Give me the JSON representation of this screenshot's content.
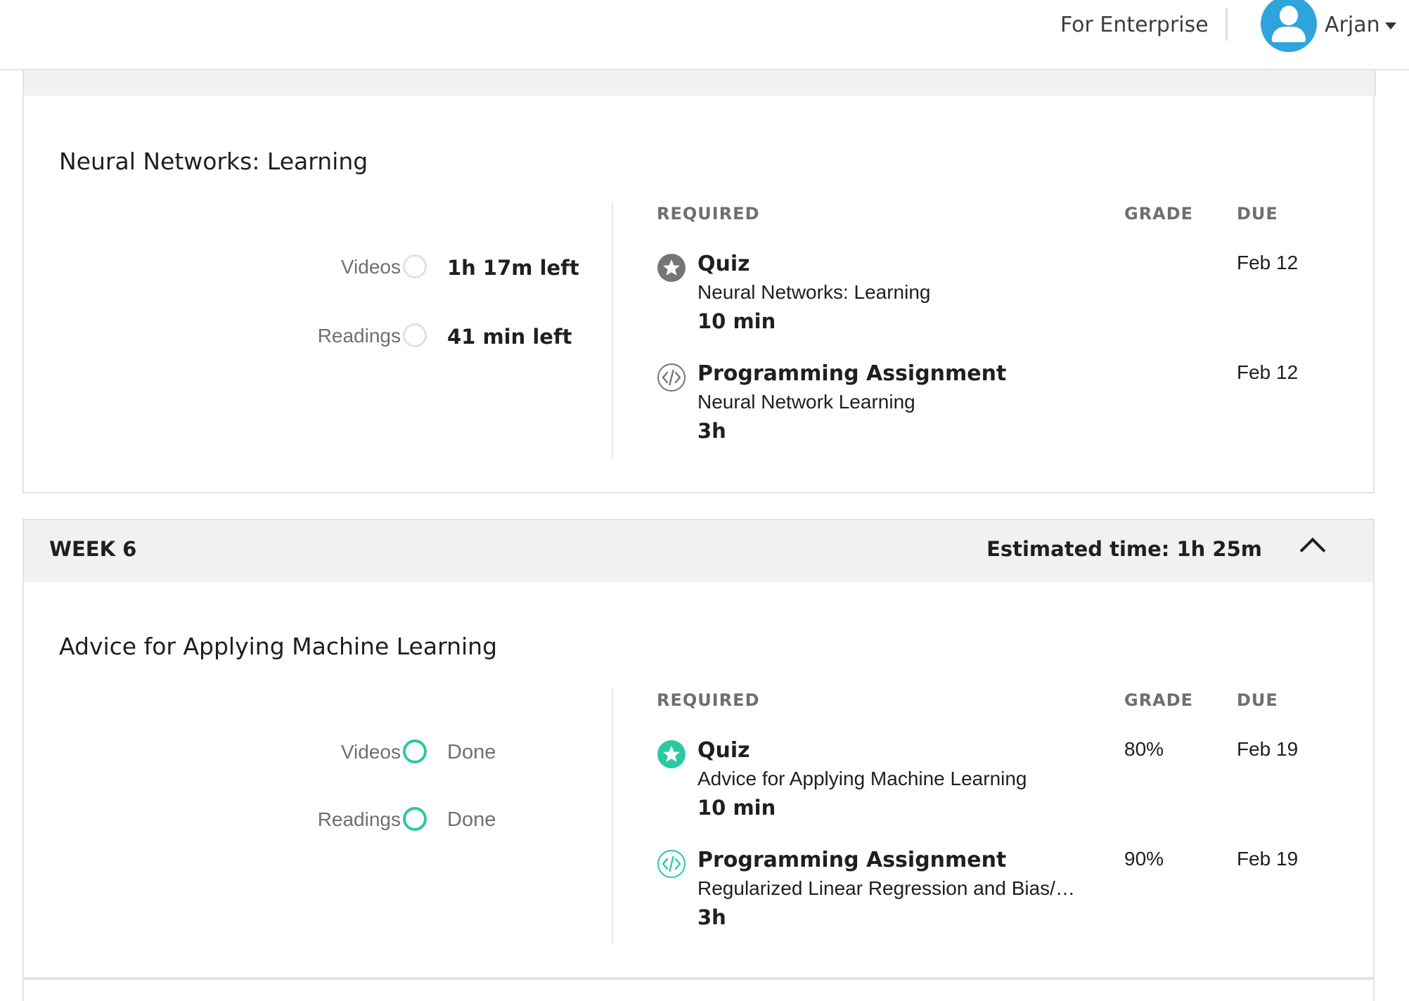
{
  "header": {
    "enterprise_link": "For Enterprise",
    "user_name": "Arjan",
    "avatar_color": "#2fa4dc"
  },
  "colors": {
    "done_green": "#2bc9a0",
    "pending_gray": "#757575",
    "strip_bg": "#f1f1f1"
  },
  "sections": [
    {
      "lesson_title": "Neural Networks: Learning",
      "progress": [
        {
          "label": "Videos",
          "status": "1h 17m left",
          "state": "pending"
        },
        {
          "label": "Readings",
          "status": "41 min left",
          "state": "pending"
        }
      ],
      "columns": {
        "required": "REQUIRED",
        "grade": "GRADE",
        "due": "DUE"
      },
      "items": [
        {
          "icon": "star-icon",
          "type": "Quiz",
          "name": "Neural Networks: Learning",
          "duration": "10 min",
          "grade": "",
          "due": "Feb 12",
          "state": "pending"
        },
        {
          "icon": "code-icon",
          "type": "Programming Assignment",
          "name": "Neural Network Learning",
          "duration": "3h",
          "grade": "",
          "due": "Feb 12",
          "state": "pending"
        }
      ]
    },
    {
      "week_label": "WEEK 6",
      "estimated_time": "Estimated time: 1h 25m",
      "lesson_title": "Advice for Applying Machine Learning",
      "progress": [
        {
          "label": "Videos",
          "status": "Done",
          "state": "done"
        },
        {
          "label": "Readings",
          "status": "Done",
          "state": "done"
        }
      ],
      "columns": {
        "required": "REQUIRED",
        "grade": "GRADE",
        "due": "DUE"
      },
      "items": [
        {
          "icon": "star-icon",
          "type": "Quiz",
          "name": "Advice for Applying Machine Learning",
          "duration": "10 min",
          "grade": "80%",
          "due": "Feb 19",
          "state": "done"
        },
        {
          "icon": "code-icon",
          "type": "Programming Assignment",
          "name": "Regularized Linear Regression and Bias/…",
          "duration": "3h",
          "grade": "90%",
          "due": "Feb 19",
          "state": "done"
        }
      ]
    }
  ]
}
